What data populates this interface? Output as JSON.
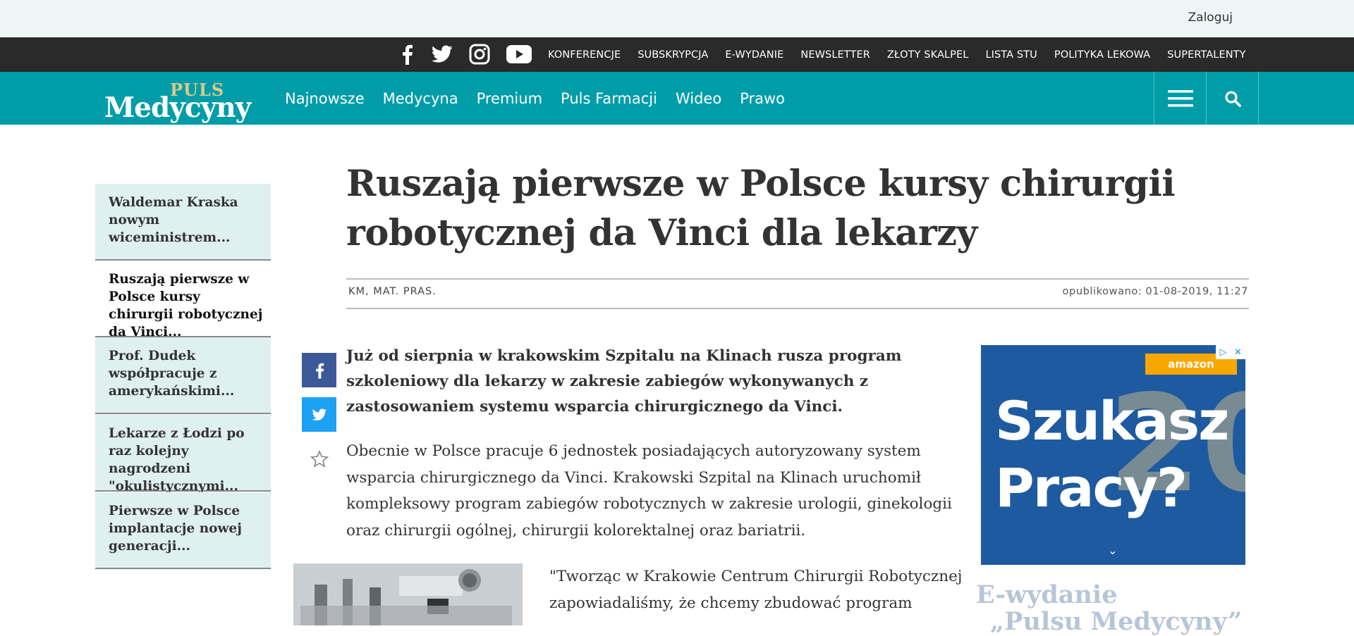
{
  "top": {
    "login": "Zaloguj"
  },
  "social": {
    "facebook": "facebook-icon",
    "twitter": "twitter-icon",
    "instagram": "instagram-icon",
    "youtube": "youtube-icon"
  },
  "dark_links": [
    "KONFERENCJE",
    "SUBSKRYPCJA",
    "E-WYDANIE",
    "NEWSLETTER",
    "ZŁOTY SKALPEL",
    "LISTA STU",
    "POLITYKA LEKOWA",
    "SUPERTALENTY"
  ],
  "logo": {
    "top": "PULS",
    "bottom": "Medycyny"
  },
  "nav": [
    "Najnowsze",
    "Medycyna",
    "Premium",
    "Puls Farmacji",
    "Wideo",
    "Prawo"
  ],
  "nav_icons": {
    "menu": "hamburger-menu-icon",
    "search": "search-icon"
  },
  "sidebar": [
    "Waldemar Kraska nowym wiceministrem...",
    "Ruszają pierwsze w Polsce kursy chirurgii robotycznej da Vinci...",
    "Prof. Dudek współpracuje z amerykańskimi...",
    "Lekarze z Łodzi po raz kolejny nagrodzeni \"okulistycznymi...",
    "Pierwsze w Polsce implantacje nowej generacji..."
  ],
  "article": {
    "title_line1": "Ruszają pierwsze w Polsce kursy chirurgii",
    "title_line2": "robotycznej da Vinci dla lekarzy",
    "author": "KM, MAT. PRAS.",
    "published": "opublikowano: 01-08-2019, 11:27",
    "lead": "Już od sierpnia w krakowskim Szpitalu na Klinach rusza program szkoleniowy dla lekarzy w zakresie zabiegów wykonywanych z zastosowaniem systemu wsparcia chirurgicznego da Vinci.",
    "body": "Obecnie w Polsce pracuje 6 jednostek posiadających autoryzowany system wsparcia chirurgicznego da Vinci. Krakowski Szpital na Klinach uruchomił kompleksowy program zabiegów robotycznych w zakresie urologii, ginekologii oraz chirurgii ogólnej, chirurgii kolorektalnej oraz bariatrii.",
    "quote": "\"Tworząc w Krakowie Centrum Chirurgii Robotycznej zapowiadaliśmy, że chcemy zbudować program"
  },
  "share": {
    "facebook": "facebook-icon",
    "twitter": "twitter-icon",
    "favorite": "star-icon"
  },
  "ad": {
    "badge": "amazon",
    "line1": "Szukasz",
    "line2": "Pracy?",
    "number": "20"
  },
  "ewydanie": {
    "line1": "E-wydanie",
    "line2": "„Pulsu Medycyny”"
  }
}
